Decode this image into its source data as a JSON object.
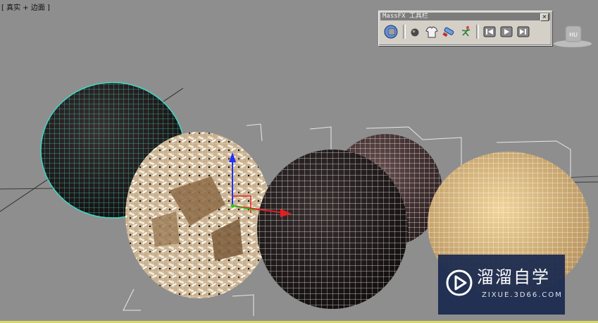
{
  "viewport": {
    "label": "[ 真实 + 边面 ]",
    "background": "#8e8e8e"
  },
  "massfx_toolbar": {
    "title": "MassFX 工具栏",
    "close_glyph": "×",
    "tools": [
      {
        "name": "world-params-icon"
      },
      {
        "name": "rigid-body-icon"
      },
      {
        "name": "mcloth-icon"
      },
      {
        "name": "constraint-icon"
      },
      {
        "name": "ragdoll-icon"
      },
      {
        "name": "reset-simulation-icon"
      },
      {
        "name": "play-simulation-icon"
      },
      {
        "name": "step-simulation-icon"
      }
    ]
  },
  "hu_badge": {
    "text": "HU"
  },
  "watermark": {
    "title": "溜溜自学",
    "subtitle": "ZIXUE.3D66.COM"
  },
  "colors": {
    "selected_wire": "#3fd9c6",
    "white_wire": "#ffffff",
    "tan_sphere": "#d9b77e",
    "dark_sphere": "#2a2424"
  }
}
